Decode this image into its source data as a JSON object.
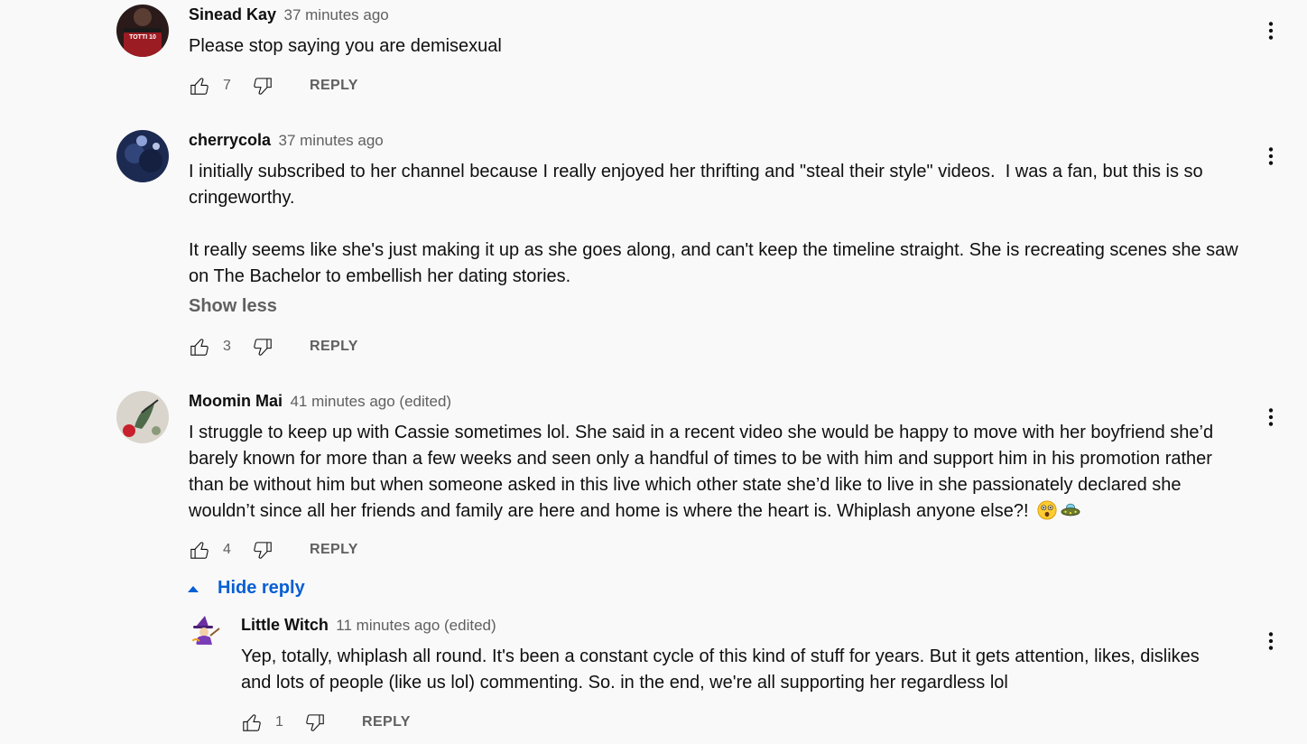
{
  "comments": [
    {
      "author": "Sinead Kay",
      "time": "37 minutes ago",
      "text": "Please stop saying you are demisexual",
      "likes": "7",
      "reply_label": "REPLY",
      "avatar_text": "TOTTI 10"
    },
    {
      "author": "cherrycola",
      "time": "37 minutes ago",
      "text": "I initially subscribed to her channel because I really enjoyed her thrifting and \"steal their style\" videos.  I was a fan, but this is so cringeworthy.\n\nIt really seems like she's just making it up as she goes along, and can't keep the timeline straight. She is recreating scenes she saw on The Bachelor to embellish her dating stories.",
      "show_less": "Show less",
      "likes": "3",
      "reply_label": "REPLY"
    },
    {
      "author": "Moomin Mai",
      "time": "41 minutes ago (edited)",
      "text": "I struggle to keep up with Cassie sometimes lol. She said in a recent video she would be happy to move with her boyfriend she’d barely known for more than a few weeks and seen only a handful of times to be with him and support him in his promotion rather than be without him but when someone asked in this live which other state she’d like to live in she passionately declared she wouldn’t since all her friends and family are here and home is where the heart is. Whiplash anyone else?!",
      "emojis": [
        "astonished-face",
        "ufo"
      ],
      "likes": "4",
      "reply_label": "REPLY",
      "hide_reply_label": "Hide reply"
    }
  ],
  "reply": {
    "author": "Little Witch",
    "time": "11 minutes ago (edited)",
    "text": "Yep, totally, whiplash all round. It's been a constant cycle of this kind of stuff for years. But it gets attention, likes, dislikes and lots of people (like us lol) commenting. So. in the end, we're all supporting her regardless lol",
    "likes": "1",
    "reply_label": "REPLY"
  },
  "colors": {
    "background": "#f9f9f9",
    "text": "#0f0f0f",
    "secondary": "#606060",
    "link": "#065fd4"
  }
}
